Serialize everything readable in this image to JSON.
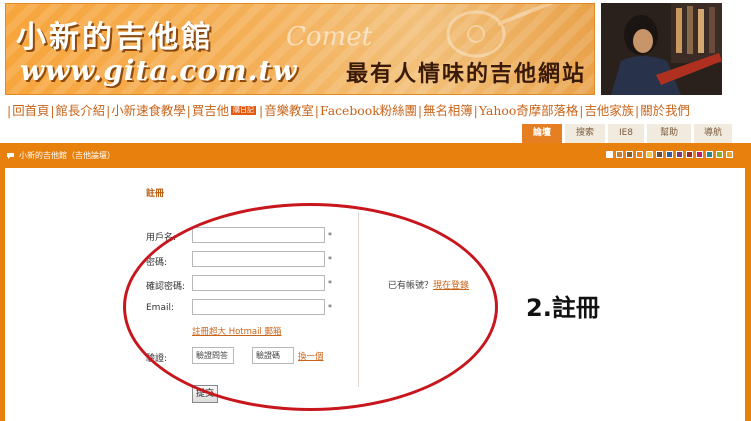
{
  "banner": {
    "site_name": "小新的吉他館",
    "site_url": "www.gita.com.tw",
    "comet": "Comet",
    "slogan": "最有人情味的吉他網站"
  },
  "nav": {
    "items": [
      "回首頁",
      "館長介紹",
      "小新速食教學",
      "買吉他",
      "音樂教室",
      "Facebook粉絲團",
      "無名相簿",
      "Yahoo奇摩部落格",
      "吉他家族",
      "關於我們"
    ],
    "badge": "購日記"
  },
  "tabs": [
    {
      "label": "論壇",
      "active": true
    },
    {
      "label": "搜索",
      "active": false
    },
    {
      "label": "IE8",
      "active": false
    },
    {
      "label": "幫助",
      "active": false
    },
    {
      "label": "導航",
      "active": false
    }
  ],
  "breadcrumb": {
    "text": "小新的吉他館（吉他論壇）"
  },
  "swatch_colors": [
    "#ffffff",
    "#c47a3a",
    "#8b5a2b",
    "#e67e22",
    "#f2c94c",
    "#6a4a3a",
    "#3a5a9a",
    "#7a3a7a",
    "#9a2a2a",
    "#c02060",
    "#2a8a8a",
    "#8ab02a",
    "#e8a020"
  ],
  "form": {
    "title": "註冊",
    "username_label": "用戶名:",
    "password_label": "密碼:",
    "confirm_label": "確認密碼:",
    "email_label": "Email:",
    "required_mark": "*",
    "hotmail_link": "註冊超大 Hotmail 郵箱",
    "captcha_label": "驗證:",
    "question_placeholder": "驗證問答",
    "code_placeholder": "驗證碼",
    "refresh_link": "換一個",
    "submit_label": "提交"
  },
  "side": {
    "have_account": "已有帳號？",
    "login_link": "現在登錄"
  },
  "annotation": {
    "text": "2.註冊",
    "color": "#c8161d"
  }
}
